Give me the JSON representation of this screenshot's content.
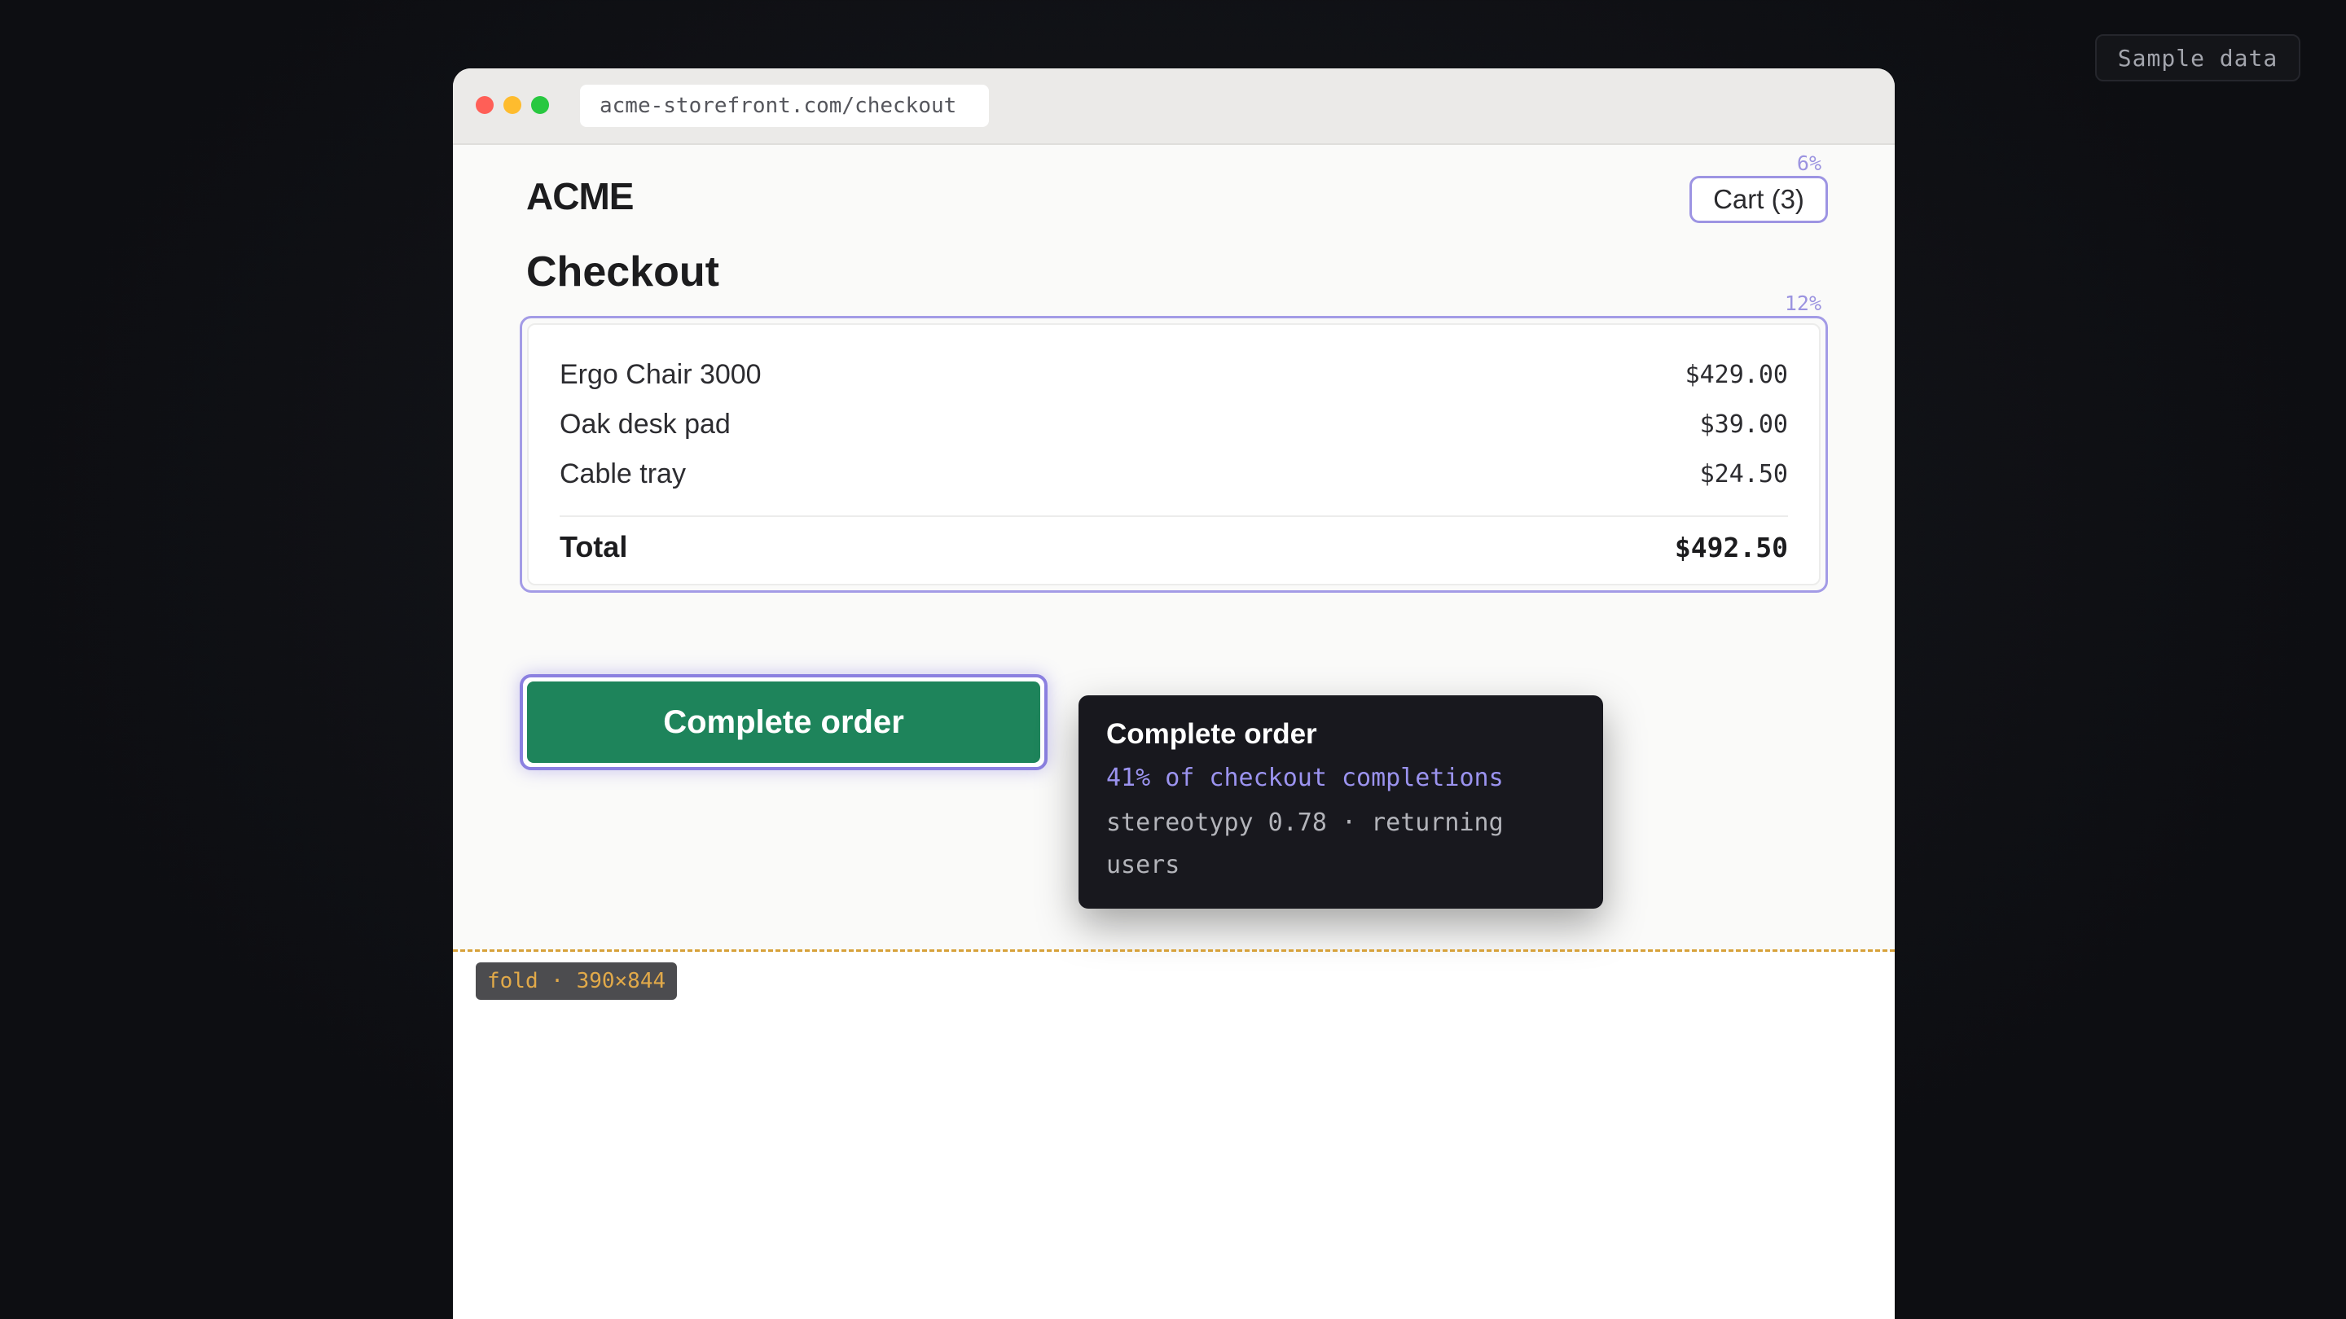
{
  "badge": {
    "label": "Sample data"
  },
  "browser": {
    "url": "acme-storefront.com/checkout"
  },
  "header": {
    "brand": "ACME",
    "cart_label": "Cart (3)",
    "cart_click_share": "6%"
  },
  "page": {
    "title": "Checkout"
  },
  "summary": {
    "click_share": "12%",
    "items": [
      {
        "name": "Ergo Chair 3000",
        "price": "$429.00"
      },
      {
        "name": "Oak desk pad",
        "price": "$39.00"
      },
      {
        "name": "Cable tray",
        "price": "$24.50"
      }
    ],
    "total_label": "Total",
    "total_value": "$492.50"
  },
  "cta": {
    "label": "Complete order"
  },
  "tooltip": {
    "title": "Complete order",
    "stat": "41% of checkout completions",
    "meta": "stereotypy 0.78 · returning users"
  },
  "fold": {
    "label": "fold · 390×844"
  },
  "colors": {
    "accent_outline": "#a39be6",
    "cta_green": "#1e845b",
    "fold_line": "#d7a13a",
    "tooltip_stat": "#9b93ef"
  },
  "icons": {
    "window_controls": [
      "close-dot",
      "minimize-dot",
      "maximize-dot"
    ]
  }
}
